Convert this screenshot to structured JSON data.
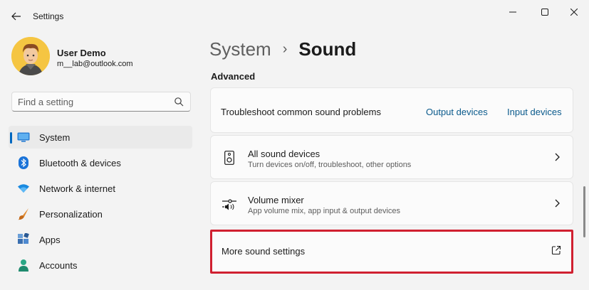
{
  "window": {
    "title": "Settings"
  },
  "profile": {
    "name": "User Demo",
    "email": "m__lab@outlook.com"
  },
  "search": {
    "placeholder": "Find a setting"
  },
  "sidebar": {
    "items": [
      {
        "label": "System",
        "icon": "monitor-icon",
        "active": true
      },
      {
        "label": "Bluetooth & devices",
        "icon": "bluetooth-icon",
        "active": false
      },
      {
        "label": "Network & internet",
        "icon": "wifi-icon",
        "active": false
      },
      {
        "label": "Personalization",
        "icon": "brush-icon",
        "active": false
      },
      {
        "label": "Apps",
        "icon": "apps-icon",
        "active": false
      },
      {
        "label": "Accounts",
        "icon": "person-icon",
        "active": false
      }
    ]
  },
  "breadcrumb": {
    "parent": "System",
    "separator": "›",
    "current": "Sound"
  },
  "main": {
    "section_title": "Advanced",
    "troubleshoot": {
      "label": "Troubleshoot common sound problems",
      "output_link": "Output devices",
      "input_link": "Input devices"
    },
    "all_devices": {
      "title": "All sound devices",
      "subtitle": "Turn devices on/off, troubleshoot, other options",
      "icon": "speaker-icon"
    },
    "volume_mixer": {
      "title": "Volume mixer",
      "subtitle": "App volume mix, app input & output devices",
      "icon": "mixer-icon"
    },
    "more_settings": {
      "label": "More sound settings",
      "icon": "external-link-icon"
    }
  },
  "colors": {
    "accent": "#0067c0",
    "highlight_border": "#d02030",
    "link": "#0a5a8c"
  }
}
